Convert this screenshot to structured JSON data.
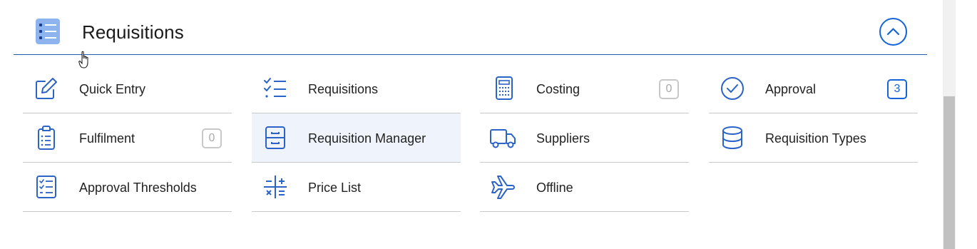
{
  "header": {
    "title": "Requisitions",
    "icon": "list-icon",
    "collapse_icon": "chevron-up-icon"
  },
  "colors": {
    "accent": "#1565d8",
    "icon_blue": "#2b63c6",
    "header_icon_bg": "#8eb4ef",
    "active_row": "#eff3fb",
    "divider": "#c9c9c9"
  },
  "items": [
    {
      "label": "Quick Entry",
      "icon": "edit-icon"
    },
    {
      "label": "Requisitions",
      "icon": "checklist-icon"
    },
    {
      "label": "Costing",
      "icon": "calculator-icon",
      "badge": "0"
    },
    {
      "label": "Approval",
      "icon": "check-circle-icon",
      "badge": "3"
    },
    {
      "label": "Fulfilment",
      "icon": "clipboard-icon",
      "badge": "0"
    },
    {
      "label": "Requisition Manager",
      "icon": "cabinet-icon"
    },
    {
      "label": "Suppliers",
      "icon": "truck-icon"
    },
    {
      "label": "Requisition Types",
      "icon": "database-icon"
    },
    {
      "label": "Approval Thresholds",
      "icon": "checklist-doc-icon"
    },
    {
      "label": "Price List",
      "icon": "math-operators-icon"
    },
    {
      "label": "Offline",
      "icon": "airplane-icon"
    }
  ]
}
